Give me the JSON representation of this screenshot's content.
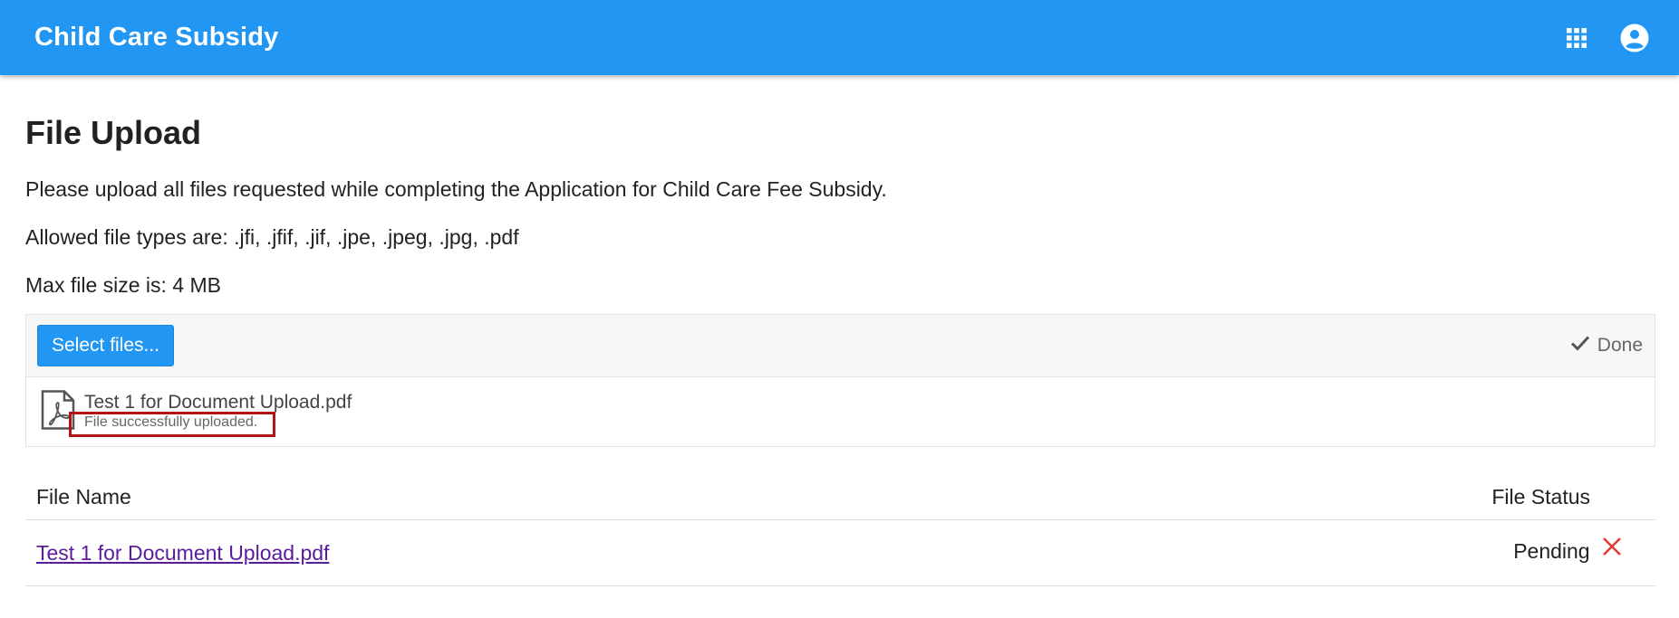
{
  "app_bar": {
    "title": "Child Care Subsidy",
    "apps_icon": "apps-grid-icon",
    "account_icon": "account-circle-icon",
    "color": "#2196f3"
  },
  "page": {
    "title": "File Upload",
    "instructions": "Please upload all files requested while completing the Application for Child Care Fee Subsidy.",
    "allowed_types": "Allowed file types are: .jfi, .jfif, .jif, .jpe, .jpeg, .jpg, .pdf",
    "max_size": "Max file size is: 4 MB"
  },
  "uploader": {
    "select_label": "Select files...",
    "status_label": "Done",
    "status_icon": "check-icon",
    "file": {
      "icon": "pdf-file-icon",
      "name": "Test 1 for Document Upload.pdf",
      "message": "File successfully uploaded."
    }
  },
  "table": {
    "columns": [
      "File Name",
      "File Status"
    ],
    "rows": [
      {
        "name": "Test 1 for Document Upload.pdf",
        "status": "Pending",
        "remove_icon": "close-icon"
      }
    ]
  },
  "colors": {
    "accent": "#2196f3",
    "link": "#5b1c9c",
    "remove": "#e53935",
    "highlight": "#b01414"
  }
}
